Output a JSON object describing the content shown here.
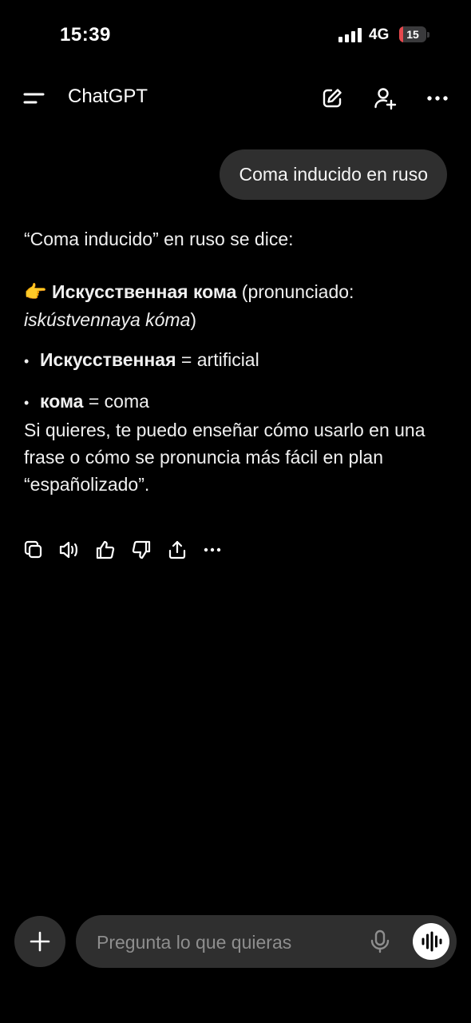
{
  "status_bar": {
    "time": "15:39",
    "network": "4G",
    "battery": "15",
    "battery_level": 0.15
  },
  "header": {
    "title": "ChatGPT"
  },
  "conversation": {
    "user_message": "Coma inducido en ruso",
    "assistant": {
      "intro": "“Coma inducido” en ruso se dice:",
      "emoji": "👉",
      "term_bold": "Искусственная кома",
      "pron_open": " (pronunciado: ",
      "pron_italic": "iskústvennaya kóma",
      "pron_close": ")",
      "bullets": [
        {
          "term": "Искусственная",
          "rest": " = artificial"
        },
        {
          "term": "кома",
          "rest": " = coma"
        }
      ],
      "closing": "Si quieres, te puedo enseñar cómo usarlo en una frase o cómo se pronuncia más fácil en plan “españolizado”."
    }
  },
  "composer": {
    "placeholder": "Pregunta lo que quieras"
  }
}
